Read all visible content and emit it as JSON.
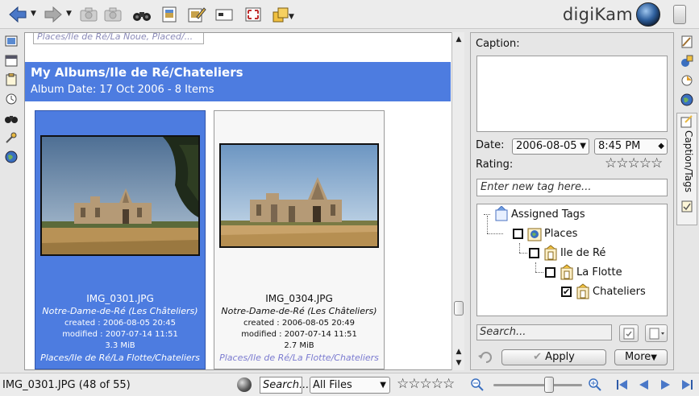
{
  "app": {
    "logo_text": "digiKam"
  },
  "toolbar": {
    "buttons": [
      "back-icon",
      "forward-icon",
      "import-camera-icon",
      "export-camera-icon",
      "search-binoculars-icon",
      "view-image-icon",
      "edit-image-icon",
      "slideshow-icon",
      "fullscreen-icon",
      "album-actions-icon"
    ]
  },
  "main": {
    "previous_album_path": "Places/Ile de Ré/La Noue, Placed/...",
    "album_header": {
      "title": "My Albums/Ile de Ré/Chateliers",
      "subtitle": "Album Date: 17 Oct 2006 - 8 Items"
    },
    "items": [
      {
        "name": "IMG_0301.JPG",
        "caption": "Notre-Dame-de-Ré (Les Châteliers)",
        "created": "created : 2006-08-05 20:45",
        "modified": "modified : 2007-07-14 11:51",
        "size": "3.3 MiB",
        "tags": "Places/Ile de Ré/La Flotte/Chateliers",
        "selected": true
      },
      {
        "name": "IMG_0304.JPG",
        "caption": "Notre-Dame-de-Ré (Les Châteliers)",
        "created": "created : 2006-08-05 20:49",
        "modified": "modified : 2007-07-14 11:51",
        "size": "2.7 MiB",
        "tags": "Places/Ile de Ré/La Flotte/Chateliers",
        "selected": false
      }
    ]
  },
  "sidebar_right": {
    "caption_label": "Caption:",
    "caption_value": "",
    "date_label": "Date:",
    "date_value": "2006-08-05",
    "time_value": "8:45 PM",
    "rating_label": "Rating:",
    "rating_value": 0,
    "new_tag_placeholder": "Enter new tag here...",
    "tree": {
      "root": "Assigned Tags",
      "nodes": [
        {
          "label": "Places",
          "checked": false
        },
        {
          "label": "Ile de Ré",
          "checked": false
        },
        {
          "label": "La Flotte",
          "checked": false
        },
        {
          "label": "Chateliers",
          "checked": true
        }
      ]
    },
    "search_placeholder": "Search...",
    "apply_label": "Apply",
    "more_label": "More",
    "vertical_tab_label": "Caption/Tags"
  },
  "statusbar": {
    "item_info": "IMG_0301.JPG (48 of 55)",
    "search_placeholder": "Search...",
    "filter_value": "All Files",
    "rating_filter": 0,
    "zoom_level": 0.6
  },
  "colors": {
    "selection_blue": "#4d7ce0",
    "header_blue": "#4d7ce0",
    "tag_link": "#7b7bd0"
  }
}
